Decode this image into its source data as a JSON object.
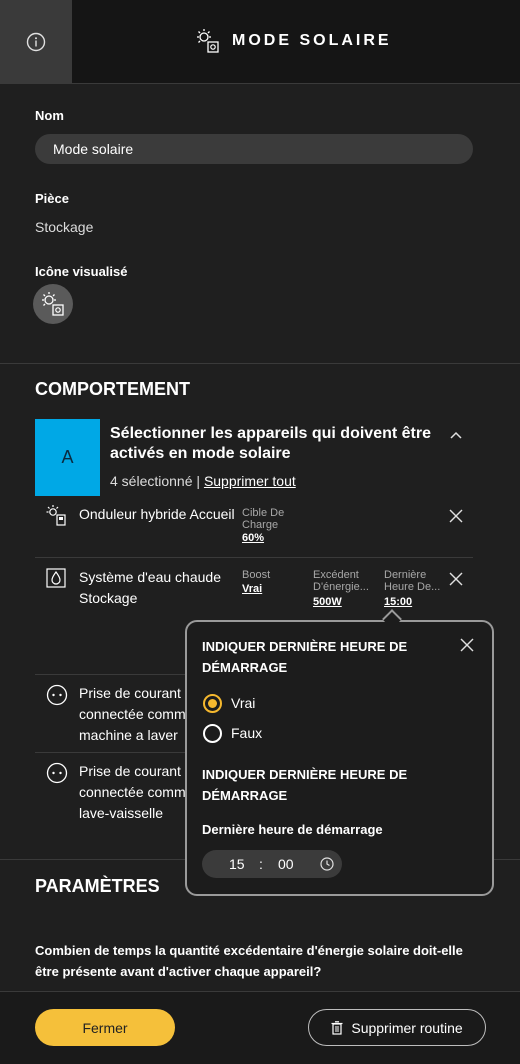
{
  "header": {
    "title": "MODE SOLAIRE",
    "info_icon": "info-icon",
    "title_icon": "solar-mode-icon"
  },
  "form": {
    "name_label": "Nom",
    "name_value": "Mode solaire",
    "room_label": "Pièce",
    "room_value": "Stockage",
    "icon_label": "Icône visualisé",
    "icon_value": "solar-mode-icon"
  },
  "behavior": {
    "title": "COMPORTEMENT",
    "avatar_letter": "A",
    "select_title": "Sélectionner les appareils qui doivent être activés en mode solaire",
    "selected_count": "4 sélectionné",
    "separator": "|",
    "remove_all": "Supprimer tout",
    "devices": [
      {
        "name": "Onduleur hybride Accueil",
        "icon": "solar-inverter-icon",
        "attrs": [
          {
            "label": "Cible De Charge",
            "value": "60%"
          }
        ]
      },
      {
        "name_line1": "Système d'eau chaude",
        "name_line2": "Stockage",
        "icon": "water-heater-icon",
        "attrs": [
          {
            "label": "Boost",
            "value": "Vrai"
          },
          {
            "label": "Excédent D'énergie...",
            "value": "500W"
          },
          {
            "label": "Dernière Heure De...",
            "value": "15:00"
          }
        ]
      },
      {
        "name_line1": "Prise de courant",
        "name_line2": "connectée comm",
        "name_line3": "machine a laver",
        "icon": "smart-plug-icon"
      },
      {
        "name_line1": "Prise de courant",
        "name_line2": "connectée comm",
        "name_line3": "lave-vaisselle",
        "icon": "smart-plug-icon"
      }
    ]
  },
  "popup": {
    "heading1": "INDIQUER DERNIÈRE HEURE DE DÉMARRAGE",
    "option_true": "Vrai",
    "option_false": "Faux",
    "selected": "Vrai",
    "heading2": "INDIQUER DERNIÈRE HEURE DE DÉMARRAGE",
    "time_label": "Dernière heure de démarrage",
    "hour": "15",
    "colon": ":",
    "minute": "00"
  },
  "params": {
    "title": "PARAMÈTRES",
    "question": "Combien de temps la quantité excédentaire d'énergie solaire doit-elle être présente avant d'activer chaque appareil?"
  },
  "footer": {
    "close_label": "Fermer",
    "delete_label": "Supprimer routine"
  },
  "colors": {
    "accent": "#f5c03a",
    "radio": "#f5b82e",
    "avatar": "#00a8e6",
    "background": "#1f1f1f"
  }
}
